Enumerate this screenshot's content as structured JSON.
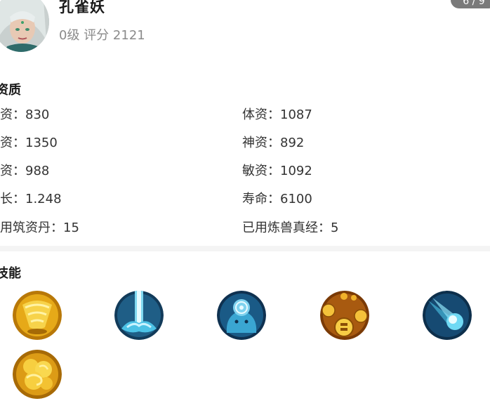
{
  "header": {
    "name": "孔雀妖",
    "level": "0级",
    "rating_label": "评分",
    "rating_value": "2121",
    "pager": "6 / 9"
  },
  "aptitude": {
    "title": "资质",
    "left": [
      {
        "label": "功资：",
        "value": "830"
      },
      {
        "label": "攻资：",
        "value": "1350"
      },
      {
        "label": "法资：",
        "value": "988"
      },
      {
        "label": "成长：",
        "value": "1.248"
      },
      {
        "label": "已用筑资丹：",
        "value": "15"
      }
    ],
    "right": [
      {
        "label": "体资：",
        "value": "1087"
      },
      {
        "label": "神资：",
        "value": "892"
      },
      {
        "label": "敏资：",
        "value": "1092"
      },
      {
        "label": "寿命：",
        "value": "6100"
      },
      {
        "label": "已用炼兽真经：",
        "value": "5"
      }
    ]
  },
  "skills": {
    "title": "技能",
    "items": [
      {
        "icon": "golden-whirlwind-icon"
      },
      {
        "icon": "water-pillar-icon"
      },
      {
        "icon": "water-spirit-icon"
      },
      {
        "icon": "palace-coins-icon"
      },
      {
        "icon": "comet-icon"
      },
      {
        "icon": "golden-cloud-icon"
      }
    ]
  },
  "colors": {
    "gold": "#e0a41e",
    "blue": "#1d5f8e",
    "divider": "#f4f4f4"
  }
}
